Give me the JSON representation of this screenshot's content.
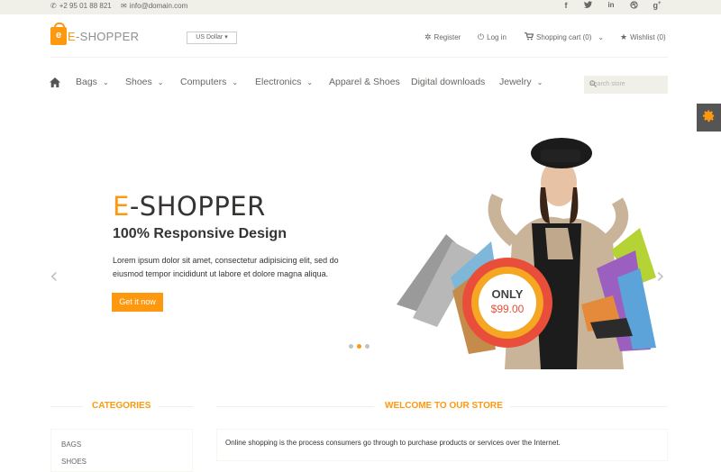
{
  "topbar": {
    "phone": "+2 95 01 88 821",
    "email": "info@domain.com",
    "social": [
      "facebook-icon",
      "twitter-icon",
      "linkedin-icon",
      "dribbble-icon",
      "google-plus-icon"
    ]
  },
  "header": {
    "logo_e": "E",
    "logo_rest": "-SHOPPER",
    "currency": "US Dollar",
    "register": "Register",
    "login": "Log in",
    "cart": "Shopping cart (0)",
    "wishlist": "Wishlist (0)"
  },
  "nav": {
    "items": [
      "Bags",
      "Shoes",
      "Computers",
      "Electronics",
      "Apparel & Shoes",
      "Digital downloads",
      "Jewelry"
    ],
    "search_placeholder": "Search store"
  },
  "slider": {
    "title_e": "E",
    "title_rest": "-SHOPPER",
    "subtitle": "100% Responsive Design",
    "text": "Lorem ipsum dolor sit amet, consectetur adipisicing elit, sed do eiusmod tempor incididunt ut labore et dolore magna aliqua.",
    "button": "Get it now",
    "badge_top": "ONLY",
    "badge_price": "$99.00"
  },
  "categories": {
    "title": "CATEGORIES",
    "items": [
      "BAGS",
      "SHOES"
    ]
  },
  "welcome": {
    "title": "WELCOME TO OUR STORE",
    "text": "Online shopping is the process consumers go through to purchase products or services over the Internet."
  },
  "colors": {
    "accent": "#fe980f",
    "topbar": "#f0f0e9",
    "text": "#696763",
    "dark": "#363432"
  }
}
